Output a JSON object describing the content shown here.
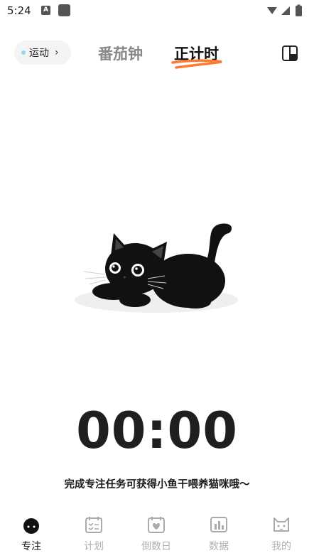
{
  "status_bar": {
    "time": "5:24",
    "a_badge": "A"
  },
  "header": {
    "chip_label": "运动",
    "chip_arrow": "›",
    "tabs": [
      {
        "label": "番茄钟",
        "active": false
      },
      {
        "label": "正计时",
        "active": true
      }
    ],
    "accent_color": "#ff7a2f",
    "right_icon": "layout-icon"
  },
  "timer": {
    "value": "00:00"
  },
  "hint": "完成专注任务可获得小鱼干喂养猫咪哦～",
  "tabbar": {
    "items": [
      {
        "label": "专注",
        "icon": "tomato-icon",
        "active": true
      },
      {
        "label": "计划",
        "icon": "calendar-list-icon",
        "active": false
      },
      {
        "label": "倒数日",
        "icon": "calendar-heart-icon",
        "active": false
      },
      {
        "label": "数据",
        "icon": "bar-chart-icon",
        "active": false
      },
      {
        "label": "我的",
        "icon": "cat-face-icon",
        "active": false
      }
    ]
  }
}
